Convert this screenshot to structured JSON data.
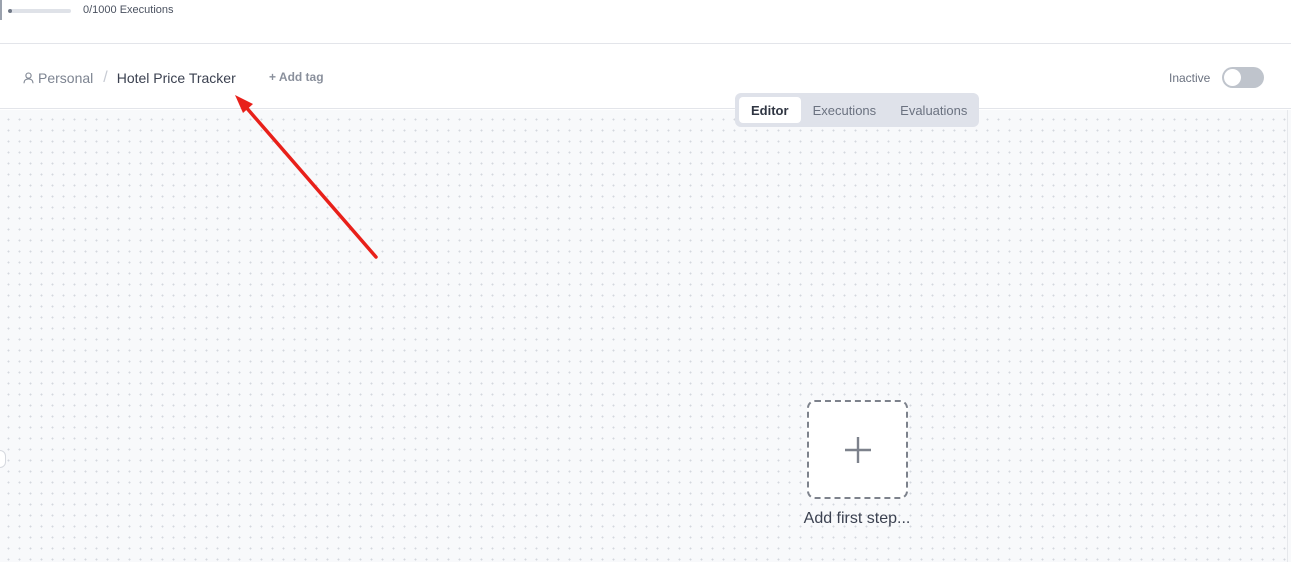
{
  "usage": {
    "label": "0/1000 Executions",
    "used": 0,
    "limit": 1000,
    "fill_fraction": 0
  },
  "breadcrumb": {
    "project_icon": "person-icon",
    "project": "Personal",
    "separator": "/",
    "workflow_name": "Hotel Price Tracker"
  },
  "tags": {
    "add_label": "+ Add tag"
  },
  "activation": {
    "label": "Inactive",
    "active": false
  },
  "tabs": [
    {
      "label": "Editor",
      "active": true
    },
    {
      "label": "Executions",
      "active": false
    },
    {
      "label": "Evaluations",
      "active": false
    }
  ],
  "canvas": {
    "add_step_icon": "plus-icon",
    "add_step_label": "Add first step..."
  },
  "annotation": {
    "type": "arrow",
    "color": "#e8201a"
  },
  "colors": {
    "canvas_background": "#f8f9fb",
    "tab_bar_background": "#dfe2ea",
    "toggle_off": "#bfc4cc"
  }
}
